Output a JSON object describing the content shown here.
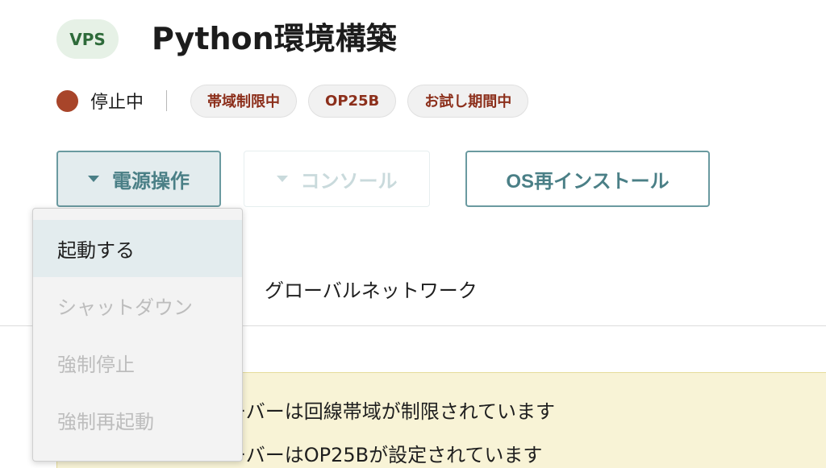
{
  "header": {
    "badge": "VPS",
    "title": "Python環境構築"
  },
  "status": {
    "state": "停止中",
    "dot_color": "#a8452a",
    "tags": [
      "帯域制限中",
      "OP25B",
      "お試し期間中"
    ]
  },
  "toolbar": {
    "power_label": "電源操作",
    "console_label": "コンソール",
    "reinstall_label": "OS再インストール"
  },
  "power_menu": {
    "items": [
      {
        "label": "起動する",
        "enabled": true
      },
      {
        "label": "シャットダウン",
        "enabled": false
      },
      {
        "label": "強制停止",
        "enabled": false
      },
      {
        "label": "強制再起動",
        "enabled": false
      }
    ]
  },
  "tabs": {
    "global_network": "グローバルネットワーク"
  },
  "notice": {
    "line1": "ーバーは回線帯域が制限されています",
    "line2": "ーバーはOP25Bが設定されています"
  },
  "colors": {
    "accent": "#4a7f86",
    "tag_text": "#8c2f1b",
    "notice_bg": "#f8f3d6"
  }
}
